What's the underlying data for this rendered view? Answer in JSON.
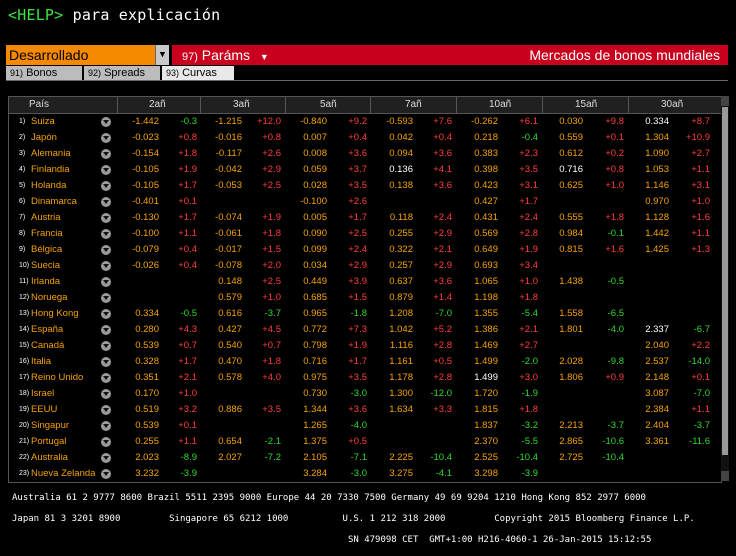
{
  "help": {
    "key": "<HELP>",
    "text": "para explicación"
  },
  "toolbar": {
    "selector_value": "Desarrollado",
    "selector_arrow": "▼",
    "params_num": "97)",
    "params_label": "Paráms",
    "params_arrow": "▼",
    "title": "Mercados de bonos mundiales"
  },
  "tabs": [
    {
      "num": "91)",
      "label": "Bonos"
    },
    {
      "num": "92)",
      "label": "Spreads"
    },
    {
      "num": "93)",
      "label": "Curvas"
    }
  ],
  "table": {
    "country_header": "País",
    "columns": [
      "2añ",
      "3añ",
      "5añ",
      "7añ",
      "10añ",
      "15añ",
      "30añ"
    ],
    "rows": [
      {
        "n": "1)",
        "country": "Suiza",
        "cells": [
          [
            "-1.442",
            "-0.3"
          ],
          [
            "-1.215",
            "+12.0"
          ],
          [
            "-0.840",
            "+9.2"
          ],
          [
            "-0.593",
            "+7.6"
          ],
          [
            "-0.262",
            "+6.1"
          ],
          [
            "0.030",
            "+9.8"
          ],
          [
            "0.334",
            "+8.7"
          ]
        ],
        "white": [
          false,
          false,
          false,
          false,
          false,
          false,
          true
        ]
      },
      {
        "n": "2)",
        "country": "Japón",
        "cells": [
          [
            "-0.023",
            "+0.8"
          ],
          [
            "-0.016",
            "+0.8"
          ],
          [
            "0.007",
            "+0.4"
          ],
          [
            "0.042",
            "+0.4"
          ],
          [
            "0.218",
            "-0.4"
          ],
          [
            "0.559",
            "+0.1"
          ],
          [
            "1.304",
            "+10.9"
          ]
        ],
        "white": [
          false,
          false,
          false,
          false,
          false,
          false,
          false
        ]
      },
      {
        "n": "3)",
        "country": "Alemania",
        "cells": [
          [
            "-0.154",
            "+1.8"
          ],
          [
            "-0.117",
            "+2.6"
          ],
          [
            "0.008",
            "+3.6"
          ],
          [
            "0.094",
            "+3.6"
          ],
          [
            "0.383",
            "+2.3"
          ],
          [
            "0.612",
            "+0.2"
          ],
          [
            "1.090",
            "+2.7"
          ]
        ],
        "white": [
          false,
          false,
          false,
          false,
          false,
          false,
          false
        ]
      },
      {
        "n": "4)",
        "country": "Finlandia",
        "cells": [
          [
            "-0.105",
            "+1.9"
          ],
          [
            "-0.042",
            "+2.9"
          ],
          [
            "0.059",
            "+3.7"
          ],
          [
            "0.136",
            "+4.1"
          ],
          [
            "0.398",
            "+3.5"
          ],
          [
            "0.716",
            "+0.8"
          ],
          [
            "1.053",
            "+1.1"
          ]
        ],
        "white": [
          false,
          false,
          false,
          true,
          false,
          true,
          false
        ]
      },
      {
        "n": "5)",
        "country": "Holanda",
        "cells": [
          [
            "-0.105",
            "+1.7"
          ],
          [
            "-0.053",
            "+2.5"
          ],
          [
            "0.028",
            "+3.5"
          ],
          [
            "0.138",
            "+3.6"
          ],
          [
            "0.423",
            "+3.1"
          ],
          [
            "0.625",
            "+1.0"
          ],
          [
            "1.146",
            "+3.1"
          ]
        ],
        "white": [
          false,
          false,
          false,
          false,
          false,
          false,
          false
        ]
      },
      {
        "n": "6)",
        "country": "Dinamarca",
        "cells": [
          [
            "-0.401",
            "+0.1"
          ],
          [
            "",
            ""
          ],
          [
            "-0.100",
            "+2.6"
          ],
          [
            "",
            ""
          ],
          [
            "0.427",
            "+1.7"
          ],
          [
            "",
            ""
          ],
          [
            "0.970",
            "+1.0"
          ]
        ],
        "white": [
          false,
          false,
          false,
          false,
          false,
          false,
          false
        ]
      },
      {
        "n": "7)",
        "country": "Austria",
        "cells": [
          [
            "-0.130",
            "+1.7"
          ],
          [
            "-0.074",
            "+1.9"
          ],
          [
            "0.005",
            "+1.7"
          ],
          [
            "0.118",
            "+2.4"
          ],
          [
            "0.431",
            "+2.4"
          ],
          [
            "0.555",
            "+1.8"
          ],
          [
            "1.128",
            "+1.6"
          ]
        ],
        "white": [
          false,
          false,
          false,
          false,
          false,
          false,
          false
        ]
      },
      {
        "n": "8)",
        "country": "Francia",
        "cells": [
          [
            "-0.100",
            "+1.1"
          ],
          [
            "-0.061",
            "+1.8"
          ],
          [
            "0.090",
            "+2.5"
          ],
          [
            "0.255",
            "+2.9"
          ],
          [
            "0.569",
            "+2.8"
          ],
          [
            "0.984",
            "-0.1"
          ],
          [
            "1.442",
            "+1.1"
          ]
        ],
        "white": [
          false,
          false,
          false,
          false,
          false,
          false,
          false
        ]
      },
      {
        "n": "9)",
        "country": "Bélgica",
        "cells": [
          [
            "-0.079",
            "+0.4"
          ],
          [
            "-0.017",
            "+1.5"
          ],
          [
            "0.099",
            "+2.4"
          ],
          [
            "0.322",
            "+2.1"
          ],
          [
            "0.649",
            "+1.9"
          ],
          [
            "0.815",
            "+1.6"
          ],
          [
            "1.425",
            "+1.3"
          ]
        ],
        "white": [
          false,
          false,
          false,
          false,
          false,
          false,
          false
        ]
      },
      {
        "n": "10)",
        "country": "Suecia",
        "cells": [
          [
            "-0.026",
            "+0.4"
          ],
          [
            "-0.078",
            "+2.0"
          ],
          [
            "0.034",
            "+2.9"
          ],
          [
            "0.257",
            "+2.9"
          ],
          [
            "0.693",
            "+3.4"
          ],
          [
            "",
            ""
          ],
          [
            "",
            ""
          ]
        ],
        "white": [
          false,
          false,
          false,
          false,
          false,
          false,
          false
        ]
      },
      {
        "n": "11)",
        "country": "Irlanda",
        "cells": [
          [
            "",
            ""
          ],
          [
            "0.148",
            "+2.5"
          ],
          [
            "0.449",
            "+3.9"
          ],
          [
            "0.637",
            "+3.6"
          ],
          [
            "1.065",
            "+1.0"
          ],
          [
            "1.438",
            "-0.5"
          ],
          [
            "",
            ""
          ]
        ],
        "white": [
          false,
          false,
          false,
          false,
          false,
          false,
          false
        ]
      },
      {
        "n": "12)",
        "country": "Noruega",
        "cells": [
          [
            "",
            ""
          ],
          [
            "0.579",
            "+1.0"
          ],
          [
            "0.685",
            "+1.5"
          ],
          [
            "0.879",
            "+1.4"
          ],
          [
            "1.198",
            "+1.8"
          ],
          [
            "",
            ""
          ],
          [
            "",
            ""
          ]
        ],
        "white": [
          false,
          false,
          false,
          false,
          false,
          false,
          false
        ]
      },
      {
        "n": "13)",
        "country": "Hong Kong",
        "cells": [
          [
            "0.334",
            "-0.5"
          ],
          [
            "0.616",
            "-3.7"
          ],
          [
            "0.965",
            "-1.8"
          ],
          [
            "1.208",
            "-7.0"
          ],
          [
            "1.355",
            "-5.4"
          ],
          [
            "1.558",
            "-6.5"
          ],
          [
            "",
            ""
          ]
        ],
        "white": [
          false,
          false,
          false,
          false,
          false,
          false,
          false
        ]
      },
      {
        "n": "14)",
        "country": "España",
        "cells": [
          [
            "0.280",
            "+4.3"
          ],
          [
            "0.427",
            "+4.5"
          ],
          [
            "0.772",
            "+7.3"
          ],
          [
            "1.042",
            "+5.2"
          ],
          [
            "1.386",
            "+2.1"
          ],
          [
            "1.801",
            "-4.0"
          ],
          [
            "2.337",
            "-6.7"
          ]
        ],
        "white": [
          false,
          false,
          false,
          false,
          false,
          false,
          true
        ]
      },
      {
        "n": "15)",
        "country": "Canadá",
        "cells": [
          [
            "0.539",
            "+0.7"
          ],
          [
            "0.540",
            "+0.7"
          ],
          [
            "0.798",
            "+1.9"
          ],
          [
            "1.116",
            "+2.8"
          ],
          [
            "1.469",
            "+2.7"
          ],
          [
            "",
            ""
          ],
          [
            "2.040",
            "+2.2"
          ]
        ],
        "white": [
          false,
          false,
          false,
          false,
          false,
          false,
          false
        ]
      },
      {
        "n": "16)",
        "country": "Italia",
        "cells": [
          [
            "0.328",
            "+1.7"
          ],
          [
            "0.470",
            "+1.8"
          ],
          [
            "0.716",
            "+1.7"
          ],
          [
            "1.161",
            "+0.5"
          ],
          [
            "1.499",
            "-2.0"
          ],
          [
            "2.028",
            "-9.8"
          ],
          [
            "2.537",
            "-14.0"
          ]
        ],
        "white": [
          false,
          false,
          false,
          false,
          false,
          false,
          false
        ]
      },
      {
        "n": "17)",
        "country": "Reino Unido",
        "cells": [
          [
            "0.351",
            "+2.1"
          ],
          [
            "0.578",
            "+4.0"
          ],
          [
            "0.975",
            "+3.5"
          ],
          [
            "1.178",
            "+2.8"
          ],
          [
            "1.499",
            "+3.0"
          ],
          [
            "1.806",
            "+0.9"
          ],
          [
            "2.148",
            "+0.1"
          ]
        ],
        "white": [
          false,
          false,
          false,
          false,
          true,
          false,
          false
        ]
      },
      {
        "n": "18)",
        "country": "Israel",
        "cells": [
          [
            "0.170",
            "+1.0"
          ],
          [
            "",
            ""
          ],
          [
            "0.730",
            "-3.0"
          ],
          [
            "1.300",
            "-12.0"
          ],
          [
            "1.720",
            "-1.9"
          ],
          [
            "",
            ""
          ],
          [
            "3.087",
            "-7.0"
          ]
        ],
        "white": [
          false,
          false,
          false,
          false,
          false,
          false,
          false
        ]
      },
      {
        "n": "19)",
        "country": "EEUU",
        "cells": [
          [
            "0.519",
            "+3.2"
          ],
          [
            "0.886",
            "+3.5"
          ],
          [
            "1.344",
            "+3.6"
          ],
          [
            "1.634",
            "+3.3"
          ],
          [
            "1.815",
            "+1.8"
          ],
          [
            "",
            ""
          ],
          [
            "2.384",
            "+1.1"
          ]
        ],
        "white": [
          false,
          false,
          false,
          false,
          false,
          false,
          false
        ]
      },
      {
        "n": "20)",
        "country": "Singapur",
        "cells": [
          [
            "0.539",
            "+0.1"
          ],
          [
            "",
            ""
          ],
          [
            "1.265",
            "-4.0"
          ],
          [
            "",
            ""
          ],
          [
            "1.837",
            "-3.2"
          ],
          [
            "2.213",
            "-3.7"
          ],
          [
            "2.404",
            "-3.7"
          ]
        ],
        "white": [
          false,
          false,
          false,
          false,
          false,
          false,
          false
        ]
      },
      {
        "n": "21)",
        "country": "Portugal",
        "cells": [
          [
            "0.255",
            "+1.1"
          ],
          [
            "0.654",
            "-2.1"
          ],
          [
            "1.375",
            "+0.5"
          ],
          [
            "",
            ""
          ],
          [
            "2.370",
            "-5.5"
          ],
          [
            "2.865",
            "-10.6"
          ],
          [
            "3.361",
            "-11.6"
          ]
        ],
        "white": [
          false,
          false,
          false,
          false,
          false,
          false,
          false
        ]
      },
      {
        "n": "22)",
        "country": "Australia",
        "cells": [
          [
            "2.023",
            "-8.9"
          ],
          [
            "2.027",
            "-7.2"
          ],
          [
            "2.105",
            "-7.1"
          ],
          [
            "2.225",
            "-10.4"
          ],
          [
            "2.525",
            "-10.4"
          ],
          [
            "2.725",
            "-10.4"
          ],
          [
            "",
            ""
          ]
        ],
        "white": [
          false,
          false,
          false,
          false,
          false,
          false,
          false
        ]
      },
      {
        "n": "23)",
        "country": "Nueva Zelanda",
        "cells": [
          [
            "3.232",
            "-3.9"
          ],
          [
            "",
            ""
          ],
          [
            "3.284",
            "-3.0"
          ],
          [
            "3.275",
            "-4.1"
          ],
          [
            "3.298",
            "-3.9"
          ],
          [
            "",
            ""
          ],
          [
            "",
            ""
          ]
        ],
        "white": [
          false,
          false,
          false,
          false,
          false,
          false,
          false
        ]
      }
    ]
  },
  "footer": {
    "line1": "Australia 61 2 9777 8600 Brazil 5511 2395 9000 Europe 44 20 7330 7500 Germany 49 69 9204 1210 Hong Kong 852 2977 6000",
    "line2": "Japan 81 3 3201 8900         Singapore 65 6212 1000          U.S. 1 212 318 2000         Copyright 2015 Bloomberg Finance L.P.",
    "line3": "                                                              SN 479098 CET  GMT+1:00 H216-4060-1 26-Jan-2015 15:12:55"
  }
}
